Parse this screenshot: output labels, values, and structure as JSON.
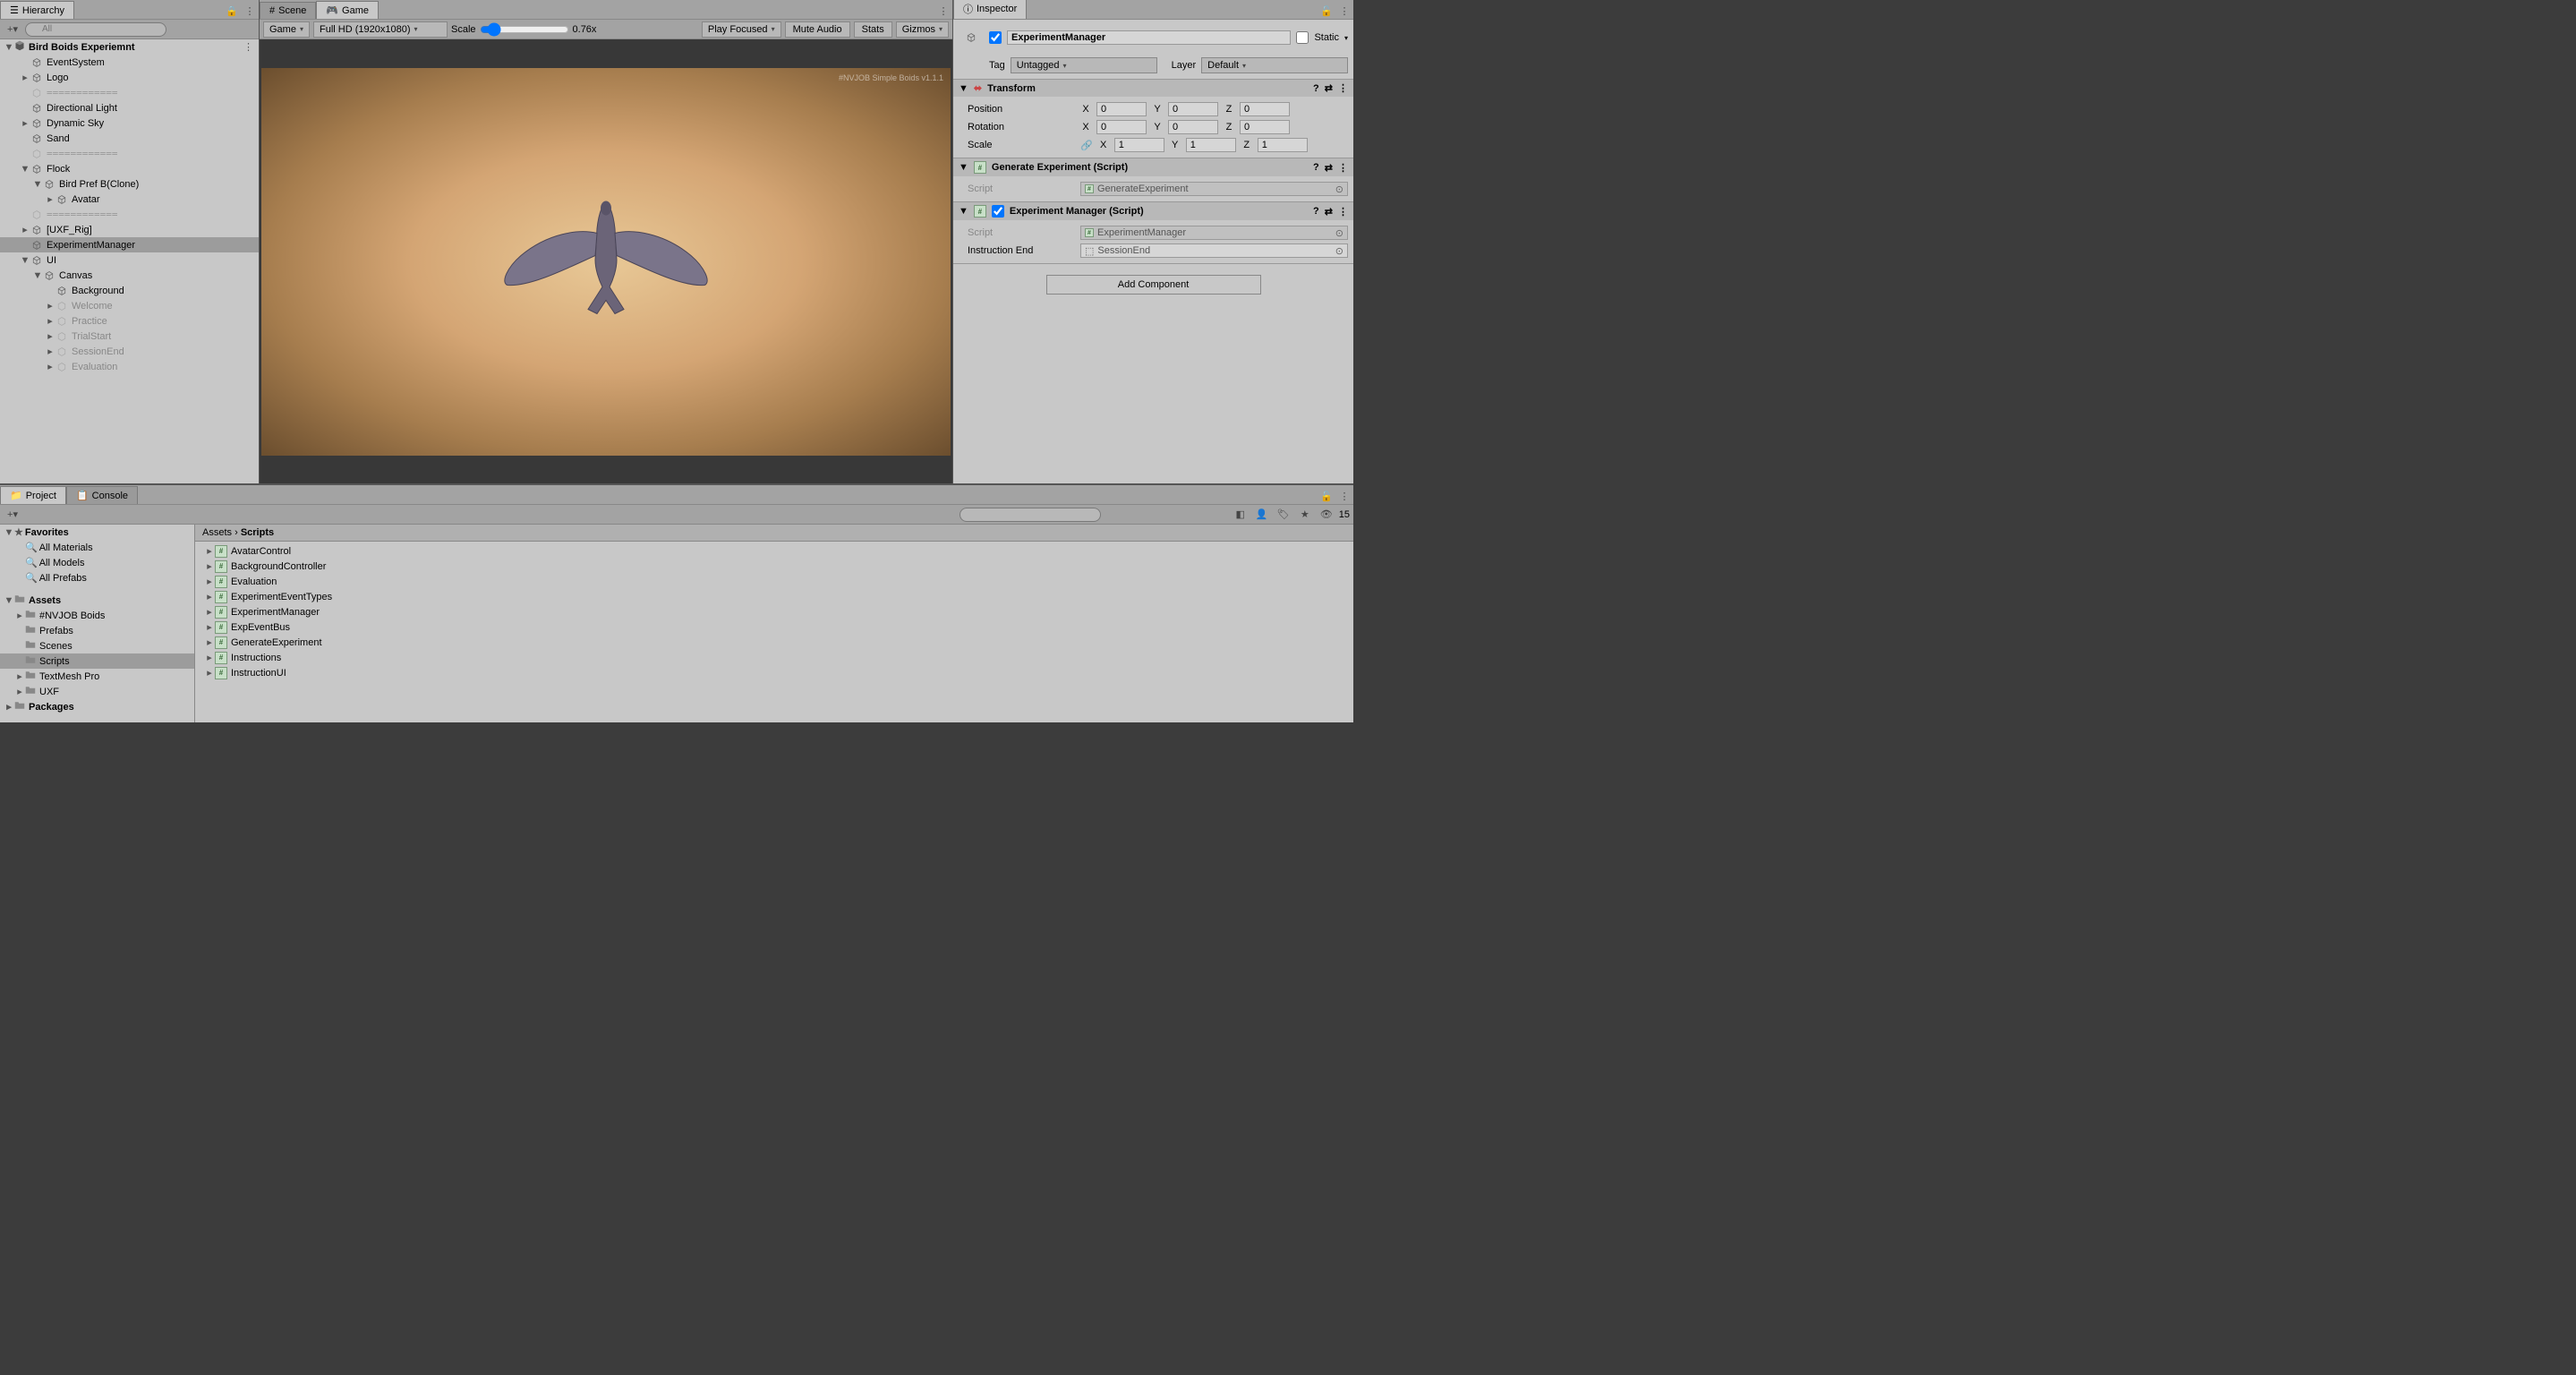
{
  "hierarchy": {
    "tab": "Hierarchy",
    "search_placeholder": "All",
    "scene": "Bird Boids Experiemnt",
    "items": {
      "eventsystem": "EventSystem",
      "logo": "Logo",
      "sep": "============",
      "dirlight": "Directional Light",
      "dynsky": "Dynamic Sky",
      "sand": "Sand",
      "flock": "Flock",
      "birdpref": "Bird Pref B(Clone)",
      "avatar": "Avatar",
      "uxf": "[UXF_Rig]",
      "expmgr": "ExperimentManager",
      "ui": "UI",
      "canvas": "Canvas",
      "background": "Background",
      "welcome": "Welcome",
      "practice": "Practice",
      "trialstart": "TrialStart",
      "sessionend": "SessionEnd",
      "evaluation": "Evaluation"
    }
  },
  "scene_tab": "Scene",
  "game_tab": "Game",
  "game_toolbar": {
    "display": "Game",
    "resolution": "Full HD (1920x1080)",
    "scale_label": "Scale",
    "scale_value": "0.76x",
    "play_focused": "Play Focused",
    "mute": "Mute Audio",
    "stats": "Stats",
    "gizmos": "Gizmos"
  },
  "watermark": "#NVJOB Simple Boids v1.1.1",
  "inspector": {
    "tab": "Inspector",
    "name": "ExperimentManager",
    "static": "Static",
    "tag_label": "Tag",
    "tag_value": "Untagged",
    "layer_label": "Layer",
    "layer_value": "Default",
    "transform": {
      "title": "Transform",
      "position": "Position",
      "rotation": "Rotation",
      "scale": "Scale",
      "px": "0",
      "py": "0",
      "pz": "0",
      "rx": "0",
      "ry": "0",
      "rz": "0",
      "sx": "1",
      "sy": "1",
      "sz": "1"
    },
    "gen_exp": {
      "title": "Generate Experiment (Script)",
      "script_label": "Script",
      "script_value": "GenerateExperiment"
    },
    "exp_mgr": {
      "title": "Experiment Manager (Script)",
      "script_label": "Script",
      "script_value": "ExperimentManager",
      "instr_end_label": "Instruction End",
      "instr_end_value": "SessionEnd"
    },
    "add_component": "Add Component"
  },
  "project": {
    "tab": "Project",
    "console_tab": "Console",
    "slider_value": "15",
    "favorites": "Favorites",
    "all_materials": "All Materials",
    "all_models": "All Models",
    "all_prefabs": "All Prefabs",
    "assets": "Assets",
    "nvjob": "#NVJOB Boids",
    "prefabs": "Prefabs",
    "scenes": "Scenes",
    "scripts": "Scripts",
    "tmp": "TextMesh Pro",
    "uxf": "UXF",
    "packages": "Packages",
    "breadcrumb_assets": "Assets",
    "breadcrumb_scripts": "Scripts",
    "files": {
      "f0": "AvatarControl",
      "f1": "BackgroundController",
      "f2": "Evaluation",
      "f3": "ExperimentEventTypes",
      "f4": "ExperimentManager",
      "f5": "ExpEventBus",
      "f6": "GenerateExperiment",
      "f7": "Instructions",
      "f8": "InstructionUI"
    }
  }
}
